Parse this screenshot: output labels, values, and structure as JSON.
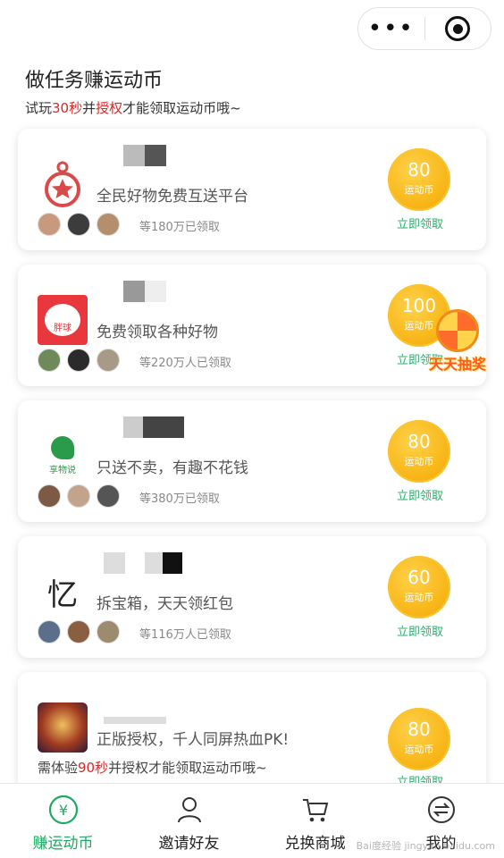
{
  "header": {
    "more_icon": "more-dots-icon",
    "close_icon": "target-icon",
    "title": "做任务赚运动币",
    "subtitle_pre": "试玩",
    "subtitle_time": "30秒",
    "subtitle_mid": "并",
    "subtitle_auth": "授权",
    "subtitle_post": "才能领取运动币哦~"
  },
  "tasks": [
    {
      "desc": "全民好物免费互送平台",
      "count": "等180万已领取",
      "coin": "80",
      "unit": "运动币",
      "action": "立即领取"
    },
    {
      "desc": "免费领取各种好物",
      "count": "等220万人已领取",
      "coin": "100",
      "unit": "运动币",
      "action": "立即领取",
      "logo_text": "胖球"
    },
    {
      "desc": "只送不卖，有趣不花钱",
      "count": "等380万已领取",
      "coin": "80",
      "unit": "运动币",
      "action": "立即领取",
      "logo_text": "享物说"
    },
    {
      "desc": "拆宝箱，天天领红包",
      "count": "等116万人已领取",
      "coin": "60",
      "unit": "运动币",
      "action": "立即领取",
      "logo_text": "忆"
    },
    {
      "desc": "正版授权，千人同屏热血PK!",
      "count": "",
      "coin": "80",
      "unit": "运动币",
      "action": "立即领取"
    }
  ],
  "footer_note": {
    "pre": "需体验",
    "time": "90秒",
    "post": "并授权才能领取运动币哦~"
  },
  "lottery": {
    "label": "天天抽奖"
  },
  "tabs": [
    {
      "label": "赚运动币",
      "icon": "yen-coin-icon"
    },
    {
      "label": "邀请好友",
      "icon": "person-icon"
    },
    {
      "label": "兑换商城",
      "icon": "cart-icon"
    },
    {
      "label": "我的",
      "icon": "profile-exchange-icon"
    }
  ],
  "watermark": "Bai度经验 jingyan.baidu.com",
  "colors": {
    "accent": "#1faa63",
    "coin": "#f7b313",
    "red": "#e02525"
  }
}
